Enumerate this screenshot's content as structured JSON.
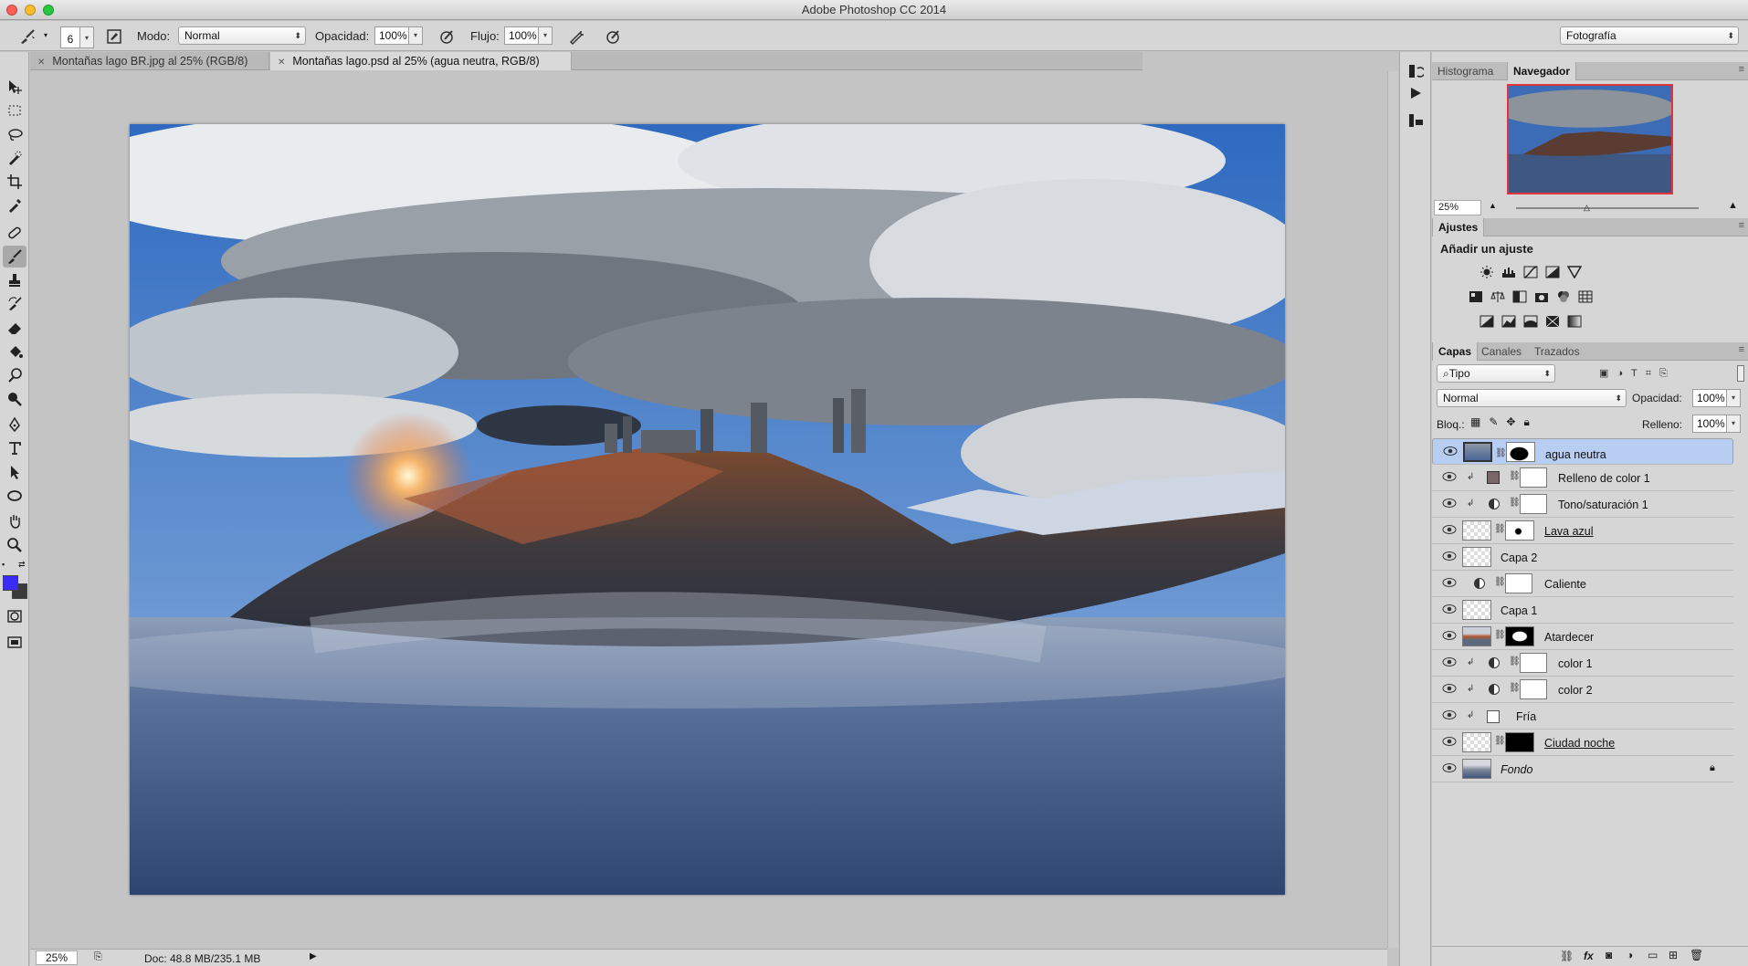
{
  "app": {
    "window_title": "Adobe Photoshop CC 2014",
    "workspace": "Fotografía"
  },
  "options": {
    "brush_size": "6",
    "mode_label": "Modo:",
    "mode_value": "Normal",
    "opacity_label": "Opacidad:",
    "opacity_value": "100%",
    "flow_label": "Flujo:",
    "flow_value": "100%"
  },
  "tabs": [
    {
      "label": "Montañas lago BR.jpg al 25% (RGB/8)"
    },
    {
      "label": "Montañas lago.psd al 25% (agua neutra, RGB/8)"
    }
  ],
  "status": {
    "zoom": "25%",
    "doc": "Doc: 48.8 MB/235.1 MB"
  },
  "navigator": {
    "tabs": [
      "Histograma",
      "Navegador"
    ],
    "zoom": "25%"
  },
  "adjustments": {
    "tab": "Ajustes",
    "heading": "Añadir un ajuste"
  },
  "layers_panel": {
    "tabs": [
      "Capas",
      "Canales",
      "Trazados"
    ],
    "filter": "Tipo",
    "blend_mode": "Normal",
    "opacity_label": "Opacidad:",
    "opacity_value": "100%",
    "lock_label": "Bloq.:",
    "fill_label": "Relleno:",
    "fill_value": "100%"
  },
  "layers": [
    {
      "name": "agua neutra",
      "selected": true
    },
    {
      "name": "Relleno de color 1"
    },
    {
      "name": "Tono/saturación 1"
    },
    {
      "name": "Lava azul"
    },
    {
      "name": "Capa 2"
    },
    {
      "name": "Caliente"
    },
    {
      "name": "Capa 1"
    },
    {
      "name": "Atardecer"
    },
    {
      "name": "color 1"
    },
    {
      "name": "color 2"
    },
    {
      "name": "Fría"
    },
    {
      "name": "Ciudad noche"
    },
    {
      "name": "Fondo"
    }
  ],
  "colors": {
    "foreground": "#3a2cf5",
    "background": "#3a3a3a",
    "selection": "#b8cdf2"
  }
}
